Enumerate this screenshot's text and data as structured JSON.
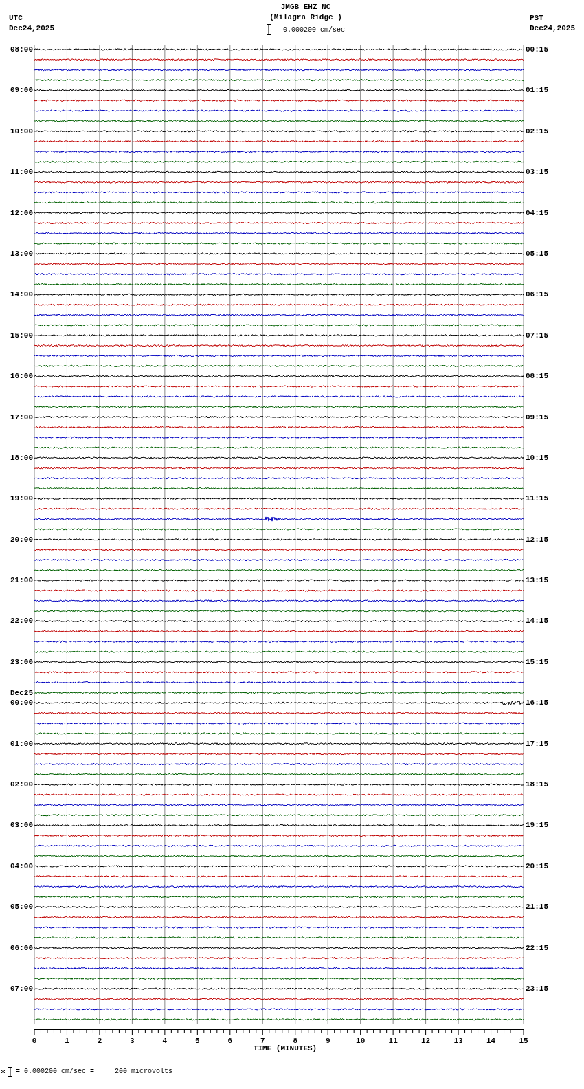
{
  "header": {
    "station": "JMGB EHZ NC",
    "location": "(Milagra Ridge )",
    "scale": "= 0.000200 cm/sec",
    "left_zone": "UTC",
    "left_date": "Dec24,2025",
    "right_zone": "PST",
    "right_date": "Dec24,2025"
  },
  "trace_colors": [
    {
      "color": "#000000"
    },
    {
      "color": "#c00000"
    },
    {
      "color": "#0000c0"
    },
    {
      "color": "#006000"
    }
  ],
  "hours": [
    {
      "utc": "08:00",
      "pst": "00:15"
    },
    {
      "utc": "09:00",
      "pst": "01:15"
    },
    {
      "utc": "10:00",
      "pst": "02:15"
    },
    {
      "utc": "11:00",
      "pst": "03:15"
    },
    {
      "utc": "12:00",
      "pst": "04:15"
    },
    {
      "utc": "13:00",
      "pst": "05:15"
    },
    {
      "utc": "14:00",
      "pst": "06:15"
    },
    {
      "utc": "15:00",
      "pst": "07:15"
    },
    {
      "utc": "16:00",
      "pst": "08:15"
    },
    {
      "utc": "17:00",
      "pst": "09:15"
    },
    {
      "utc": "18:00",
      "pst": "10:15"
    },
    {
      "utc": "19:00",
      "pst": "11:15"
    },
    {
      "utc": "20:00",
      "pst": "12:15"
    },
    {
      "utc": "21:00",
      "pst": "13:15"
    },
    {
      "utc": "22:00",
      "pst": "14:15"
    },
    {
      "utc": "23:00",
      "pst": "15:15"
    },
    {
      "utc": "00:00",
      "date": "Dec25",
      "pst": "16:15"
    },
    {
      "utc": "01:00",
      "pst": "17:15"
    },
    {
      "utc": "02:00",
      "pst": "18:15"
    },
    {
      "utc": "03:00",
      "pst": "19:15"
    },
    {
      "utc": "04:00",
      "pst": "20:15"
    },
    {
      "utc": "05:00",
      "pst": "21:15"
    },
    {
      "utc": "06:00",
      "pst": "22:15"
    },
    {
      "utc": "07:00",
      "pst": "23:15"
    }
  ],
  "x_axis": {
    "ticks": [
      "0",
      "1",
      "2",
      "3",
      "4",
      "5",
      "6",
      "7",
      "8",
      "9",
      "10",
      "11",
      "12",
      "13",
      "14",
      "15"
    ],
    "label": "TIME (MINUTES)"
  },
  "footer": {
    "scale": "= 0.000200 cm/sec =     200 microvolts"
  }
}
